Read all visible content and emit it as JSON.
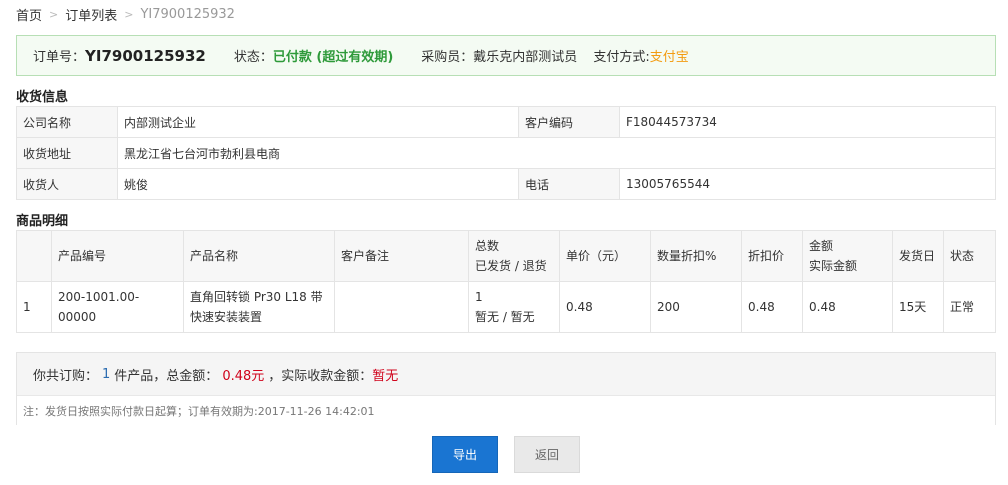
{
  "breadcrumb": {
    "home": "首页",
    "sep": ">",
    "order_list": "订单列表",
    "current": "YI7900125932"
  },
  "order": {
    "no_label": "订单号：",
    "no": "YI7900125932",
    "status_label": "状态：",
    "status": "已付款 (超过有效期)",
    "buyer_label": "采购员：",
    "buyer": "戴乐克内部测试员",
    "pay_label": "支付方式:",
    "pay": "支付宝"
  },
  "receiver": {
    "title": "收货信息",
    "company_label": "公司名称",
    "company": "内部测试企业",
    "code_label": "客户编码",
    "code": "F18044573734",
    "address_label": "收货地址",
    "address": "黑龙江省七台河市勃利县电商",
    "name_label": "收货人",
    "name": "姚俊",
    "phone_label": "电话",
    "phone": "13005765544"
  },
  "goods": {
    "title": "商品明细",
    "headers": {
      "no": "",
      "code": "产品编号",
      "name": "产品名称",
      "remark": "客户备注",
      "total": "总数",
      "shipped": "已发货 / 退货",
      "price": "单价（元）",
      "discount_qty": "数量折扣%",
      "discount_price": "折扣价",
      "amount": "金额",
      "actual_amount": "实际金额",
      "ship_day": "发货日",
      "state": "状态"
    },
    "rows": [
      {
        "no": "1",
        "code": "200-1001.00-00000",
        "name": "直角回转锁 Pr30 L18 带快速安装装置",
        "remark": "",
        "total": "1",
        "shipped": "暂无 / 暂无",
        "price": "0.48",
        "discount_qty": "200",
        "discount_price": "0.48",
        "amount": "0.48",
        "ship_day": "15天",
        "state": "正常"
      }
    ]
  },
  "summary": {
    "prefix": "你共订购：",
    "qty": "1",
    "qty_suffix": "件产品，总金额：",
    "amount": "0.48元",
    "actual_label": "，实际收款金额：",
    "actual": "暂无",
    "note": "注：发货日按照实际付款日起算；订单有效期为:2017-11-26 14:42:01"
  },
  "buttons": {
    "export": "导出",
    "back": "返回"
  },
  "colors": {
    "primary": "#1a75d2",
    "success": "#2e9a3a",
    "warning": "#f39c12",
    "danger": "#d0021b"
  }
}
